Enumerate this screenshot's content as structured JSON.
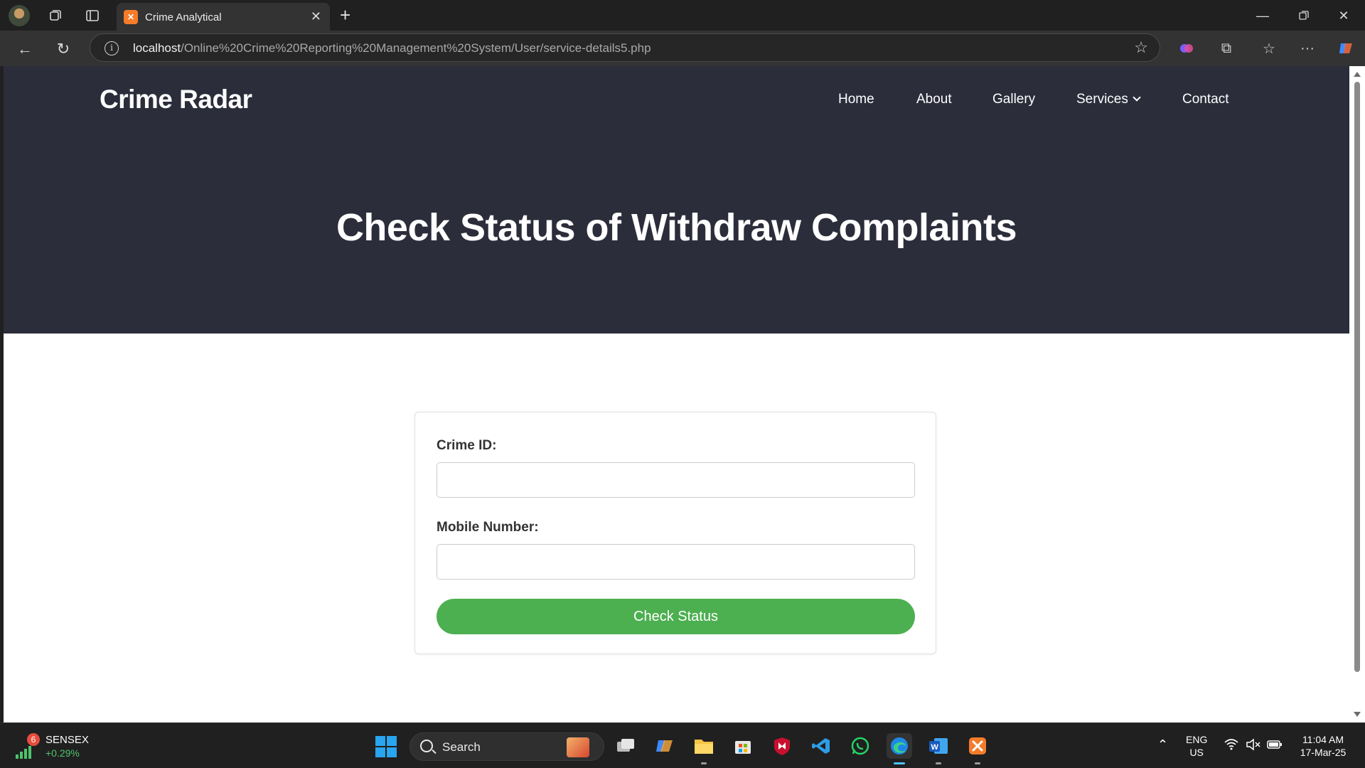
{
  "browser": {
    "tab_title": "Crime Analytical",
    "url_host": "localhost",
    "url_path": "/Online%20Crime%20Reporting%20Management%20System/User/service-details5.php"
  },
  "site": {
    "logo": "Crime Radar",
    "nav": {
      "home": "Home",
      "about": "About",
      "gallery": "Gallery",
      "services": "Services",
      "contact": "Contact"
    },
    "hero_title": "Check Status of Withdraw Complaints"
  },
  "form": {
    "crime_id_label": "Crime ID:",
    "crime_id_value": "",
    "mobile_label": "Mobile Number:",
    "mobile_value": "",
    "submit_label": "Check Status"
  },
  "taskbar": {
    "stock_name": "SENSEX",
    "stock_change": "+0.29%",
    "stock_badge": "6",
    "search_label": "Search",
    "lang_top": "ENG",
    "lang_bottom": "US",
    "time": "11:04 AM",
    "date": "17-Mar-25"
  },
  "colors": {
    "hero_bg": "#2b2d3b",
    "accent_button": "#4caf50",
    "stock_up": "#4fc46b"
  },
  "icons": {
    "tab_favicon": "xampp-icon",
    "taskbar_apps": [
      "task-view-icon",
      "copilot-icon",
      "file-explorer-icon",
      "store-icon",
      "mcafee-icon",
      "vscode-icon",
      "whatsapp-icon",
      "edge-icon",
      "word-icon",
      "xampp-icon"
    ]
  }
}
